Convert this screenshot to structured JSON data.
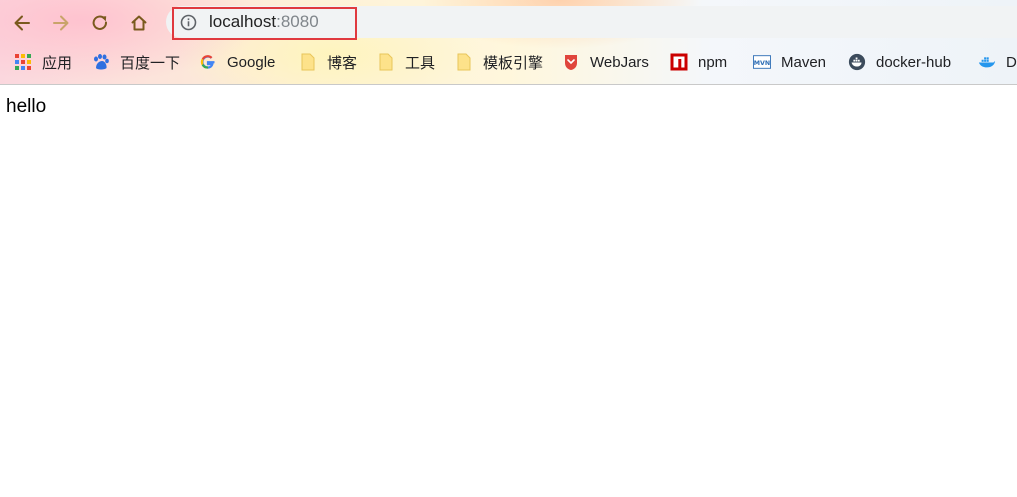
{
  "toolbar": {
    "url_host": "localhost",
    "url_port": ":8080"
  },
  "bookmarks": [
    {
      "label": "应用",
      "icon": "apps-grid-icon"
    },
    {
      "label": "百度一下",
      "icon": "baidu-paw-icon"
    },
    {
      "label": "Google",
      "icon": "google-g-icon"
    },
    {
      "label": "博客",
      "icon": "folder-icon"
    },
    {
      "label": "工具",
      "icon": "folder-icon"
    },
    {
      "label": "模板引擎",
      "icon": "folder-icon"
    },
    {
      "label": "WebJars",
      "icon": "webjars-icon"
    },
    {
      "label": "npm",
      "icon": "npm-icon"
    },
    {
      "label": "Maven",
      "icon": "maven-icon"
    },
    {
      "label": "docker-hub",
      "icon": "docker-hub-icon"
    },
    {
      "label": "D",
      "icon": "docker-whale-icon"
    }
  ],
  "page": {
    "body_text": "hello"
  },
  "colors": {
    "highlight_box": "#e0393e",
    "nav_icon": "#7a5a1e",
    "nav_icon_disabled": "#c9a46a"
  }
}
